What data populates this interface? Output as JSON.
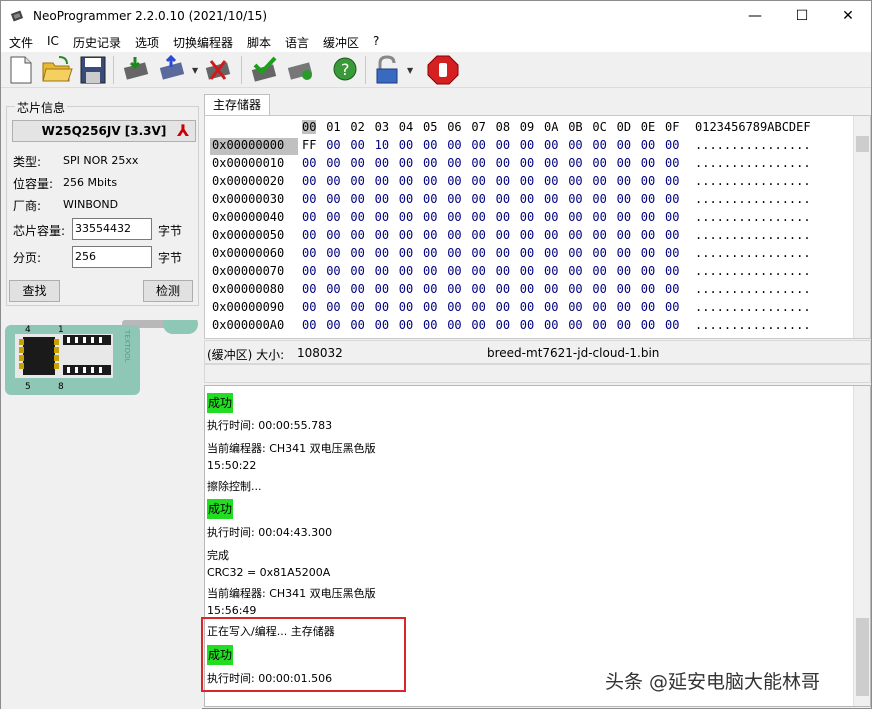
{
  "window": {
    "title": "NeoProgrammer 2.2.0.10 (2021/10/15)",
    "minimize": "—",
    "maximize": "☐",
    "close": "✕"
  },
  "menu": [
    "文件",
    "IC",
    "历史记录",
    "选项",
    "切换编程器",
    "脚本",
    "语言",
    "缓冲区",
    "?"
  ],
  "toolbar": {
    "icons": [
      "new-file-icon",
      "open-folder-icon",
      "save-disk-icon",
      "read-chip-icon",
      "write-chip-icon",
      "erase-chip-icon",
      "verify-chip-icon",
      "blank-check-icon",
      "auto-detect-icon",
      "lock-icon",
      "stop-icon"
    ]
  },
  "chip_info": {
    "group_title": "芯片信息",
    "chip_name": "W25Q256JV [3.3V]",
    "type_label": "类型:",
    "type_value": "SPI NOR 25xx",
    "capacity_label": "位容量:",
    "capacity_value": "256 Mbits",
    "vendor_label": "厂商:",
    "vendor_value": "WINBOND",
    "size_label": "芯片容量:",
    "size_value": "33554432",
    "size_unit": "字节",
    "page_label": "分页:",
    "page_value": "256",
    "page_unit": "字节",
    "find_button": "查找",
    "detect_button": "检测"
  },
  "socket": {
    "pin_1": "4",
    "pin_2": "1",
    "pin_3": "5",
    "pin_4": "8",
    "brand": "TEXTOOL"
  },
  "tabs": [
    "主存储器"
  ],
  "hex": {
    "columns": [
      "00",
      "01",
      "02",
      "03",
      "04",
      "05",
      "06",
      "07",
      "08",
      "09",
      "0A",
      "0B",
      "0C",
      "0D",
      "0E",
      "0F"
    ],
    "ascii_header": "0123456789ABCDEF",
    "rows": [
      {
        "addr": "0x00000000",
        "bytes": [
          "FF",
          "00",
          "00",
          "10",
          "00",
          "00",
          "00",
          "00",
          "00",
          "00",
          "00",
          "00",
          "00",
          "00",
          "00",
          "00"
        ],
        "ascii": "................"
      },
      {
        "addr": "0x00000010",
        "bytes": [
          "00",
          "00",
          "00",
          "00",
          "00",
          "00",
          "00",
          "00",
          "00",
          "00",
          "00",
          "00",
          "00",
          "00",
          "00",
          "00"
        ],
        "ascii": "................"
      },
      {
        "addr": "0x00000020",
        "bytes": [
          "00",
          "00",
          "00",
          "00",
          "00",
          "00",
          "00",
          "00",
          "00",
          "00",
          "00",
          "00",
          "00",
          "00",
          "00",
          "00"
        ],
        "ascii": "................"
      },
      {
        "addr": "0x00000030",
        "bytes": [
          "00",
          "00",
          "00",
          "00",
          "00",
          "00",
          "00",
          "00",
          "00",
          "00",
          "00",
          "00",
          "00",
          "00",
          "00",
          "00"
        ],
        "ascii": "................"
      },
      {
        "addr": "0x00000040",
        "bytes": [
          "00",
          "00",
          "00",
          "00",
          "00",
          "00",
          "00",
          "00",
          "00",
          "00",
          "00",
          "00",
          "00",
          "00",
          "00",
          "00"
        ],
        "ascii": "................"
      },
      {
        "addr": "0x00000050",
        "bytes": [
          "00",
          "00",
          "00",
          "00",
          "00",
          "00",
          "00",
          "00",
          "00",
          "00",
          "00",
          "00",
          "00",
          "00",
          "00",
          "00"
        ],
        "ascii": "................"
      },
      {
        "addr": "0x00000060",
        "bytes": [
          "00",
          "00",
          "00",
          "00",
          "00",
          "00",
          "00",
          "00",
          "00",
          "00",
          "00",
          "00",
          "00",
          "00",
          "00",
          "00"
        ],
        "ascii": "................"
      },
      {
        "addr": "0x00000070",
        "bytes": [
          "00",
          "00",
          "00",
          "00",
          "00",
          "00",
          "00",
          "00",
          "00",
          "00",
          "00",
          "00",
          "00",
          "00",
          "00",
          "00"
        ],
        "ascii": "................"
      },
      {
        "addr": "0x00000080",
        "bytes": [
          "00",
          "00",
          "00",
          "00",
          "00",
          "00",
          "00",
          "00",
          "00",
          "00",
          "00",
          "00",
          "00",
          "00",
          "00",
          "00"
        ],
        "ascii": "................"
      },
      {
        "addr": "0x00000090",
        "bytes": [
          "00",
          "00",
          "00",
          "00",
          "00",
          "00",
          "00",
          "00",
          "00",
          "00",
          "00",
          "00",
          "00",
          "00",
          "00",
          "00"
        ],
        "ascii": "................"
      },
      {
        "addr": "0x000000A0",
        "bytes": [
          "00",
          "00",
          "00",
          "00",
          "00",
          "00",
          "00",
          "00",
          "00",
          "00",
          "00",
          "00",
          "00",
          "00",
          "00",
          "00"
        ],
        "ascii": "................"
      }
    ]
  },
  "buffer_info": {
    "size_label": "(缓冲区) 大小:",
    "size_value": "108032",
    "filename": "breed-mt7621-jd-cloud-1.bin"
  },
  "log": [
    {
      "text": "成功",
      "status": "ok"
    },
    {
      "text": "执行时间:   00:00:55.783"
    },
    {
      "text": "当前编程器: CH341 双电压黑色版"
    },
    {
      "text": "15:50:22"
    },
    {
      "text": "擦除控制..."
    },
    {
      "text": "成功",
      "status": "ok"
    },
    {
      "text": "执行时间:   00:04:43.300"
    },
    {
      "text": "完成"
    },
    {
      "text": "CRC32 = 0x81A5200A"
    },
    {
      "text": "当前编程器: CH341 双电压黑色版"
    },
    {
      "text": "15:56:49"
    },
    {
      "text": "正在写入/编程... 主存储器"
    },
    {
      "text": "成功",
      "status": "ok"
    },
    {
      "text": "执行时间:   00:00:01.506"
    }
  ],
  "watermark": "头条 @延安电脑大能林哥",
  "colors": {
    "ok_highlight": "#22dd22",
    "hex_value": "#000080",
    "highlight_box": "#d9262c"
  }
}
